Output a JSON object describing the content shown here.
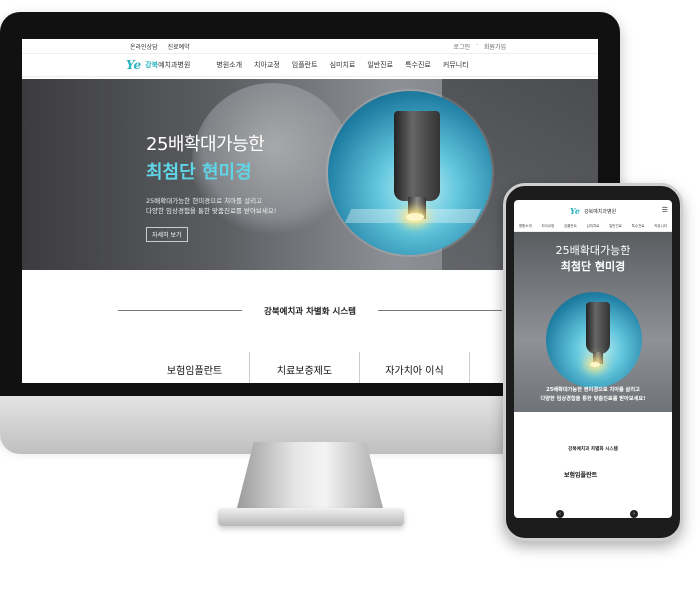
{
  "desktop": {
    "top_links": [
      "온라인상담",
      "진료예약"
    ],
    "top_right": [
      "로그인",
      "회원가입"
    ],
    "logo": {
      "mark": "Ye",
      "accent": "강북",
      "name": "예치과병원"
    },
    "menu": [
      "병원소개",
      "치아교정",
      "임플란트",
      "심미치료",
      "일반진료",
      "특수진료",
      "커뮤니티"
    ],
    "hero": {
      "line1": "25배확대가능한",
      "line2": "최첨단 현미경",
      "desc1": "25배확대가능한 현미경으로 치아를 살리고",
      "desc2": "다양한 임상경험을 통한 맞춤진료를 받아보세요!",
      "button": "자세히 보기"
    },
    "section_title": "강북예치과 차별화 시스템",
    "cards": [
      "보험임플란트",
      "치료보증제도",
      "자가치아 이식"
    ]
  },
  "mobile": {
    "logo_text": "강북예치과병원",
    "nav": [
      "병원소개",
      "치아교정",
      "임플란트",
      "심미치료",
      "일반진료",
      "특수진료",
      "커뮤니티"
    ],
    "hero_line1": "25배확대가능한",
    "hero_line2": "최첨단 현미경",
    "desc1": "25배확대가능한 현미경으로 치아를 살리고",
    "desc2": "다양한 임상경험을 통한 맞춤진료를 받아보세요!",
    "section_title": "강북예치과 차별화 시스템",
    "card_title": "보험임플란트"
  },
  "colors": {
    "accent": "#2bb3c0",
    "hero_highlight": "#5fd6e8"
  }
}
